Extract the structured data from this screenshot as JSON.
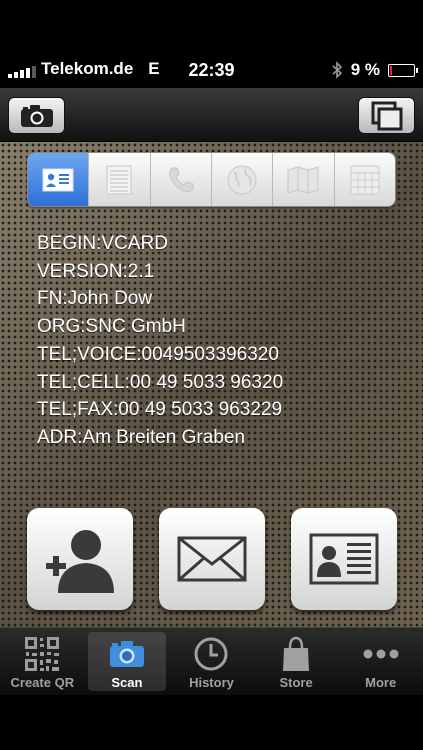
{
  "status_bar": {
    "carrier": "Telekom.de",
    "network": "E",
    "time": "22:39",
    "battery_percent": "9 %",
    "battery_level": 0.09,
    "icons": [
      "signal-icon",
      "bluetooth-icon",
      "battery-icon"
    ]
  },
  "toolbar": {
    "left_icon": "camera-icon",
    "right_icon": "copy-icon"
  },
  "segments": [
    {
      "name": "vcard",
      "icon": "contact-card-icon",
      "active": true
    },
    {
      "name": "text",
      "icon": "text-lines-icon",
      "active": false
    },
    {
      "name": "phone",
      "icon": "phone-icon",
      "active": false
    },
    {
      "name": "web",
      "icon": "globe-icon",
      "active": false
    },
    {
      "name": "map",
      "icon": "map-icon",
      "active": false
    },
    {
      "name": "calendar",
      "icon": "calendar-icon",
      "active": false
    }
  ],
  "vcard_lines": [
    "BEGIN:VCARD",
    "VERSION:2.1",
    "FN:John Dow",
    "ORG:SNC GmbH",
    "TEL;VOICE:0049503396320",
    "TEL;CELL:00 49 5033 96320",
    "TEL;FAX:00 49 5033 963229",
    "ADR:Am Breiten Graben"
  ],
  "actions": [
    {
      "name": "add-contact",
      "icon": "add-contact-icon"
    },
    {
      "name": "email",
      "icon": "envelope-icon"
    },
    {
      "name": "contact-card",
      "icon": "contact-card-icon"
    }
  ],
  "tabs": [
    {
      "label": "Create QR",
      "icon": "qr-code-icon",
      "active": false
    },
    {
      "label": "Scan",
      "icon": "camera-icon",
      "active": true
    },
    {
      "label": "History",
      "icon": "clock-icon",
      "active": false
    },
    {
      "label": "Store",
      "icon": "shopping-bag-icon",
      "active": false
    },
    {
      "label": "More",
      "icon": "more-dots-icon",
      "active": false
    }
  ],
  "colors": {
    "accent_blue": "#3a7de0",
    "battery_low": "#e22222"
  }
}
